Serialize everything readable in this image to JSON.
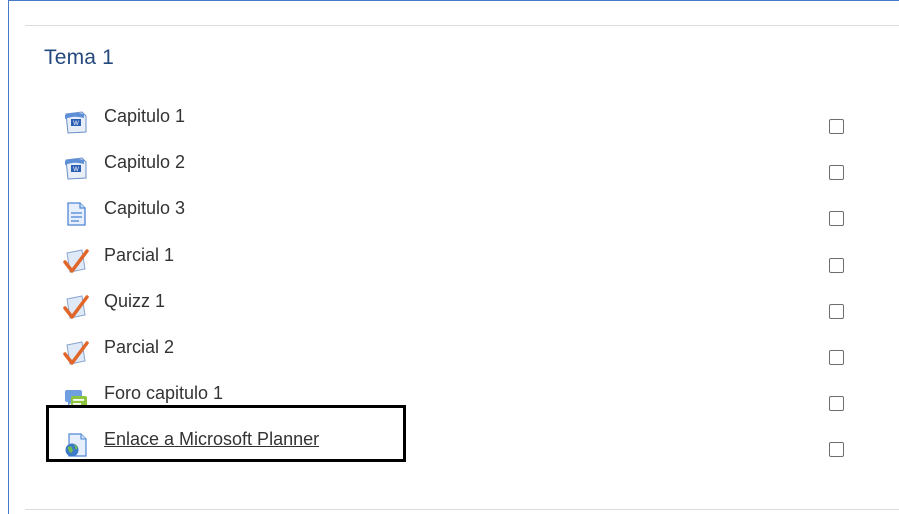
{
  "section": {
    "title": "Tema 1"
  },
  "items": [
    {
      "label": "Capitulo 1",
      "icon": "word-document-icon"
    },
    {
      "label": "Capitulo 2",
      "icon": "word-document-icon"
    },
    {
      "label": "Capitulo 3",
      "icon": "page-document-icon"
    },
    {
      "label": "Parcial 1",
      "icon": "quiz-check-icon"
    },
    {
      "label": "Quizz 1",
      "icon": "quiz-check-icon"
    },
    {
      "label": "Parcial 2",
      "icon": "quiz-check-icon"
    },
    {
      "label": "Foro capitulo 1",
      "icon": "forum-icon"
    },
    {
      "label": "Enlace a Microsoft Planner",
      "icon": "url-link-icon"
    }
  ],
  "colors": {
    "title": "#25497d",
    "frame": "#4a78c8",
    "check_orange": "#e0662a"
  }
}
